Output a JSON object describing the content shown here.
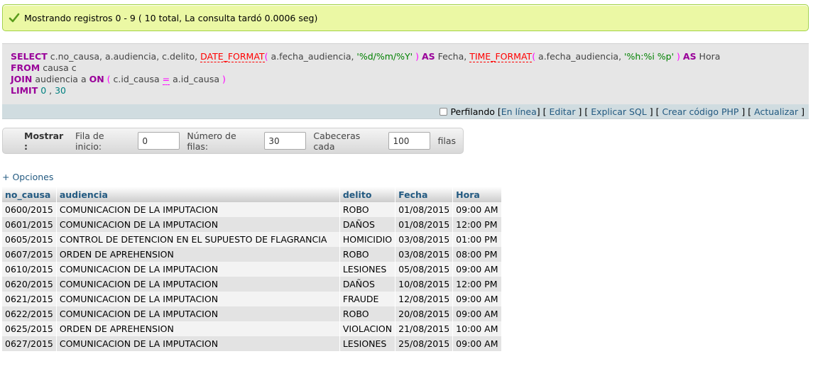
{
  "message": {
    "text": "Mostrando registros 0 - 9 ( 10 total, La consulta tardó 0.0006 seg)",
    "icon": "check-icon",
    "color": "#5a9b1b"
  },
  "sql": {
    "line1": [
      {
        "t": "SELECT",
        "c": "kw"
      },
      {
        "t": " c.no_causa, a.audiencia, c.delito, "
      },
      {
        "t": "DATE_FORMAT",
        "c": "fn"
      },
      {
        "t": "( ",
        "c": "punc"
      },
      {
        "t": "a.fecha_audiencia, "
      },
      {
        "t": "'%d/%m/%Y'",
        "c": "str"
      },
      {
        "t": " ) ",
        "c": "punc"
      },
      {
        "t": "AS",
        "c": "kw"
      },
      {
        "t": " Fecha, "
      },
      {
        "t": "TIME_FORMAT",
        "c": "fn"
      },
      {
        "t": "( ",
        "c": "punc"
      },
      {
        "t": "a.fecha_audiencia, "
      },
      {
        "t": "'%h:%i %p'",
        "c": "str"
      },
      {
        "t": " ) ",
        "c": "punc"
      },
      {
        "t": "AS",
        "c": "kw"
      },
      {
        "t": " Hora"
      }
    ],
    "line2": [
      {
        "t": "FROM",
        "c": "kw"
      },
      {
        "t": " causa c"
      }
    ],
    "line3": [
      {
        "t": "JOIN",
        "c": "kw"
      },
      {
        "t": " audiencia a "
      },
      {
        "t": "ON",
        "c": "kw"
      },
      {
        "t": " ( ",
        "c": "punc"
      },
      {
        "t": "c.id_causa "
      },
      {
        "t": "=",
        "c": "op"
      },
      {
        "t": " a.id_causa "
      },
      {
        "t": ")",
        "c": "punc"
      }
    ],
    "line4": [
      {
        "t": "LIMIT",
        "c": "kw"
      },
      {
        "t": " 0 ",
        "c": "num"
      },
      {
        "t": ","
      },
      {
        "t": " 30",
        "c": "num"
      }
    ]
  },
  "toolbar": {
    "profiling_label": "Perfilando",
    "profiling_checked": false,
    "links": [
      "En línea",
      "Editar",
      "Explicar SQL",
      "Crear código PHP",
      "Actualizar"
    ]
  },
  "navigation": {
    "show_label": "Mostrar :",
    "start_label": "Fila de inicio:",
    "start_value": "0",
    "rows_label": "Número de filas:",
    "rows_value": "30",
    "headers_label": "Cabeceras cada",
    "headers_value": "100",
    "rows_suffix": "filas"
  },
  "options_link": "+ Opciones",
  "table": {
    "columns": [
      "no_causa",
      "audiencia",
      "delito",
      "Fecha",
      "Hora"
    ],
    "rows": [
      [
        "0600/2015",
        "COMUNICACION DE LA IMPUTACION",
        "ROBO",
        "01/08/2015",
        "09:00 AM"
      ],
      [
        "0601/2015",
        "COMUNICACION DE LA IMPUTACION",
        "DAÑOS",
        "01/08/2015",
        "12:00 PM"
      ],
      [
        "0605/2015",
        "CONTROL DE DETENCION EN EL SUPUESTO DE FLAGRANCIA",
        "HOMICIDIO",
        "03/08/2015",
        "01:00 PM"
      ],
      [
        "0607/2015",
        "ORDEN DE APREHENSION",
        "ROBO",
        "03/08/2015",
        "08:00 PM"
      ],
      [
        "0610/2015",
        "COMUNICACION DE LA IMPUTACION",
        "LESIONES",
        "05/08/2015",
        "09:00 AM"
      ],
      [
        "0620/2015",
        "COMUNICACION DE LA IMPUTACION",
        "DAÑOS",
        "10/08/2015",
        "12:00 PM"
      ],
      [
        "0621/2015",
        "COMUNICACION DE LA IMPUTACION",
        "FRAUDE",
        "12/08/2015",
        "09:00 AM"
      ],
      [
        "0622/2015",
        "COMUNICACION DE LA IMPUTACION",
        "ROBO",
        "20/08/2015",
        "09:00 AM"
      ],
      [
        "0625/2015",
        "ORDEN DE APREHENSION",
        "VIOLACION",
        "21/08/2015",
        "10:00 AM"
      ],
      [
        "0627/2015",
        "COMUNICACION DE LA IMPUTACION",
        "LESIONES",
        "25/08/2015",
        "09:00 AM"
      ]
    ]
  }
}
